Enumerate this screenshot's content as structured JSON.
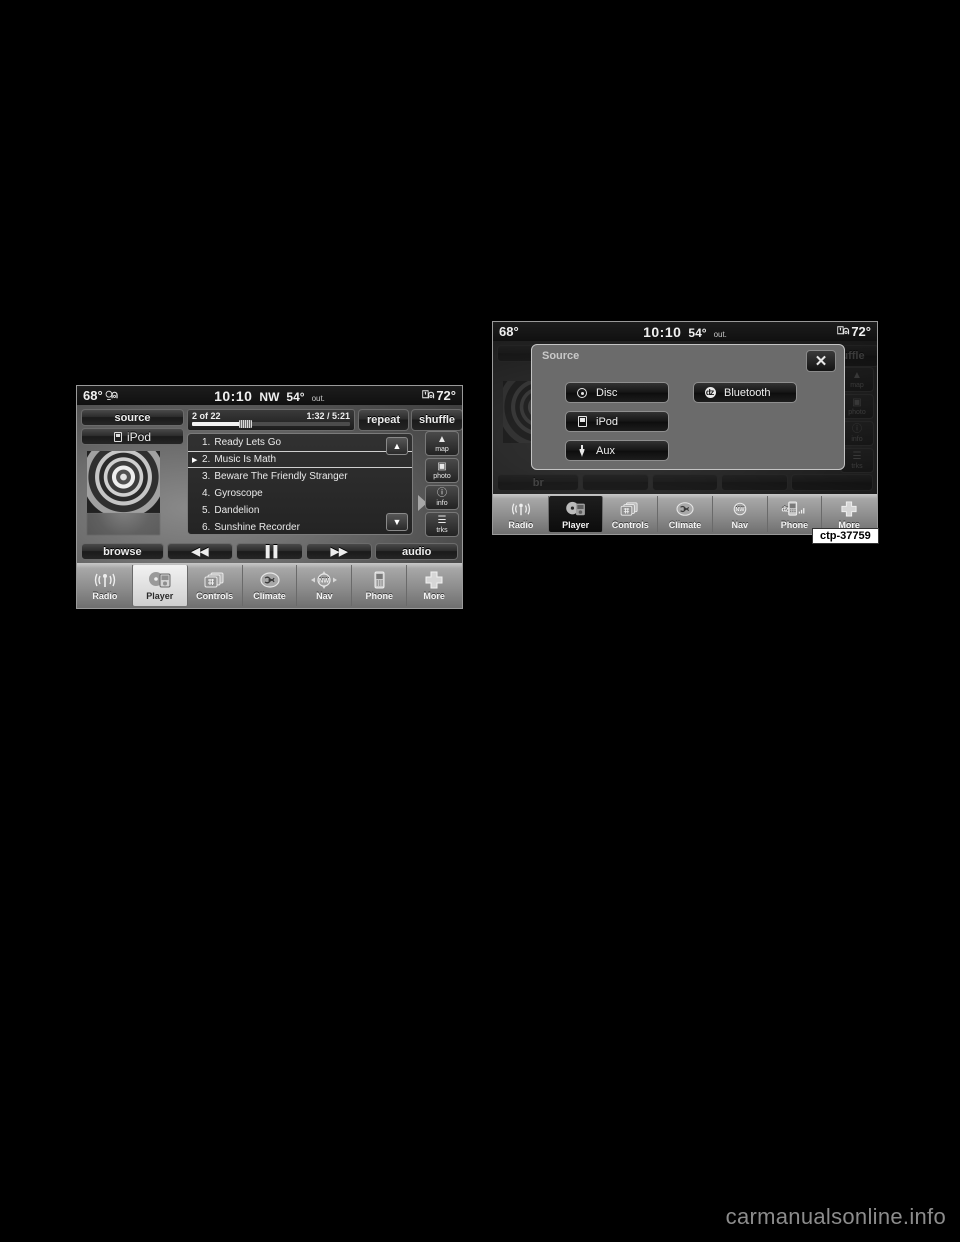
{
  "page": {
    "background_color": "#000000",
    "watermark": "carmanualsonline.info",
    "figure_tag": "ctp-37759"
  },
  "figure_left": {
    "name": "ipod-player-screen",
    "status_bar": {
      "left_temp": "68°",
      "left_icon": "heated-seat-icon",
      "time": "10:10",
      "wind_dir": "NW",
      "outside_temp": "54°",
      "outside_label": "out.",
      "right_icon": "heated-steering-icon",
      "right_temp": "72°"
    },
    "source_button": "source",
    "source_value": "iPod",
    "track_progress": {
      "track_position": "2 of 22",
      "time": "1:32 / 5:21",
      "percent": 32
    },
    "repeat_button": "repeat",
    "shuffle_button": "shuffle",
    "tracks": [
      {
        "num": "1.",
        "title": "Ready Lets Go",
        "current": false
      },
      {
        "num": "2.",
        "title": "Music Is Math",
        "current": true
      },
      {
        "num": "3.",
        "title": "Beware The Friendly Stranger",
        "current": false
      },
      {
        "num": "4.",
        "title": "Gyroscope",
        "current": false
      },
      {
        "num": "5.",
        "title": "Dandelion",
        "current": false
      },
      {
        "num": "6.",
        "title": "Sunshine Recorder",
        "current": false
      }
    ],
    "scroll_up": "▲",
    "scroll_down": "▼",
    "side_buttons": [
      {
        "label": "map",
        "icon": "map-icon"
      },
      {
        "label": "photo",
        "icon": "photo-icon"
      },
      {
        "label": "info",
        "icon": "info-icon"
      },
      {
        "label": "trks",
        "icon": "tracks-list-icon"
      }
    ],
    "transport": [
      {
        "label": "browse",
        "icon": ""
      },
      {
        "label": "",
        "icon": "◀◀"
      },
      {
        "label": "",
        "icon": "▐▐"
      },
      {
        "label": "",
        "icon": "▶▶"
      },
      {
        "label": "audio",
        "icon": ""
      }
    ],
    "nav_items": [
      {
        "label": "Radio",
        "icon": "radio-antenna-icon",
        "active": false
      },
      {
        "label": "Player",
        "icon": "media-player-icon",
        "active": true
      },
      {
        "label": "Controls",
        "icon": "controls-icon",
        "active": false
      },
      {
        "label": "Climate",
        "icon": "climate-fan-icon",
        "active": false
      },
      {
        "label": "Nav",
        "icon": "compass-nw-icon",
        "active": false
      },
      {
        "label": "Phone",
        "icon": "phone-icon",
        "active": false
      },
      {
        "label": "More",
        "icon": "plus-icon",
        "active": false
      }
    ]
  },
  "figure_right": {
    "name": "source-selection-dialog-screen",
    "status_bar": {
      "left_temp": "68°",
      "time": "10:10",
      "outside_temp": "54°",
      "outside_label": "out.",
      "right_icon": "heated-steering-icon",
      "right_temp": "72°"
    },
    "dialog": {
      "title": "Source",
      "close_label": "✕",
      "options_left": [
        {
          "label": "Disc",
          "icon": "disc-icon"
        },
        {
          "label": "iPod",
          "icon": "ipod-icon"
        },
        {
          "label": "Aux",
          "icon": "aux-plug-icon"
        }
      ],
      "options_right": [
        {
          "label": "Bluetooth",
          "icon": "bluetooth-icon"
        }
      ]
    },
    "background_ghosts": {
      "shuffle_partial": "uffle",
      "browse_partial": "br",
      "side_buttons": [
        "map",
        "photo",
        "info",
        "trks"
      ]
    },
    "nav_items": [
      {
        "label": "Radio",
        "icon": "radio-antenna-icon",
        "active": false
      },
      {
        "label": "Player",
        "icon": "media-player-icon",
        "active": true
      },
      {
        "label": "Controls",
        "icon": "controls-icon",
        "active": false
      },
      {
        "label": "Climate",
        "icon": "climate-fan-icon",
        "active": false
      },
      {
        "label": "Nav",
        "icon": "compass-nw-icon",
        "active": false
      },
      {
        "label": "Phone",
        "icon": "phone-bluetooth-icon",
        "active": false
      },
      {
        "label": "More",
        "icon": "plus-icon",
        "active": false
      }
    ]
  }
}
